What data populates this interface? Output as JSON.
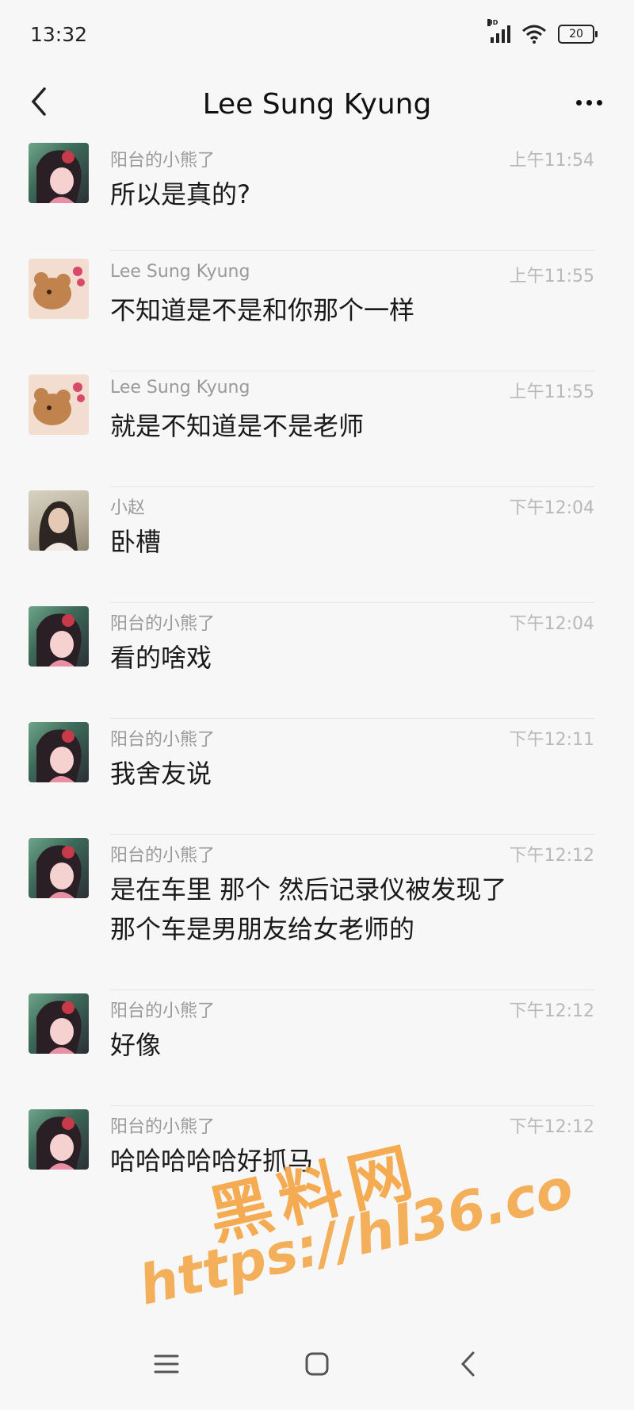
{
  "status_bar": {
    "time": "13:32",
    "battery": "20",
    "signal_label": "HD",
    "icons": [
      "signal-icon",
      "wifi-icon",
      "battery-icon"
    ]
  },
  "header": {
    "title": "Lee Sung Kyung",
    "back_icon": "chevron-left-icon",
    "more_icon": "more-dots-icon"
  },
  "messages": [
    {
      "sender": "阳台的小熊了",
      "time": "上午11:54",
      "text": "所以是真的?",
      "avatar": "anime-girl-avatar"
    },
    {
      "sender": "Lee Sung Kyung",
      "time": "上午11:55",
      "text": "不知道是不是和你那个一样",
      "avatar": "bear-avatar"
    },
    {
      "sender": "Lee Sung Kyung",
      "time": "上午11:55",
      "text": "就是不知道是不是老师",
      "avatar": "bear-avatar"
    },
    {
      "sender": "小赵",
      "time": "下午12:04",
      "text": "卧槽",
      "avatar": "photo-avatar"
    },
    {
      "sender": "阳台的小熊了",
      "time": "下午12:04",
      "text": "看的啥戏",
      "avatar": "anime-girl-avatar"
    },
    {
      "sender": "阳台的小熊了",
      "time": "下午12:11",
      "text": "我舍友说",
      "avatar": "anime-girl-avatar"
    },
    {
      "sender": "阳台的小熊了",
      "time": "下午12:12",
      "text": "是在车里 那个  然后记录仪被发现了",
      "text2": "那个车是男朋友给女老师的",
      "avatar": "anime-girl-avatar"
    },
    {
      "sender": "阳台的小熊了",
      "time": "下午12:12",
      "text": "好像",
      "avatar": "anime-girl-avatar"
    },
    {
      "sender": "阳台的小熊了",
      "time": "下午12:12",
      "text": "哈哈哈哈哈好抓马",
      "avatar": "anime-girl-avatar"
    }
  ],
  "nav_bar": {
    "icons": [
      "menu-icon",
      "home-icon",
      "back-icon"
    ]
  },
  "watermark": {
    "title": "黑料网",
    "url": "https://hl36.co"
  }
}
